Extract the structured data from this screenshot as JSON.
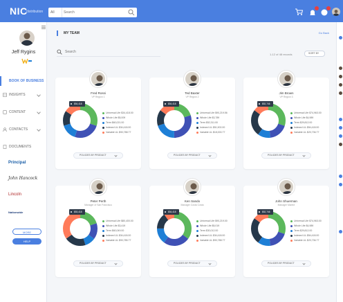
{
  "app": {
    "logo": "NIC",
    "logo_sub": "distribution"
  },
  "topbar": {
    "search_filter": "All",
    "search_placeholder": "Search"
  },
  "sidebar": {
    "profile_name": "Jeff Rygins",
    "nav": [
      {
        "label": "BOOK OF BUSINESS",
        "active": true
      },
      {
        "label": "INSIGHTS",
        "chevron": true
      },
      {
        "label": "CONTENT",
        "chevron": true
      },
      {
        "label": "CONTACTS",
        "chevron": true
      },
      {
        "label": "DOCUMENTS"
      }
    ],
    "carriers": [
      "Principal",
      "John Hancock",
      "Lincoln",
      "Nationwide"
    ],
    "more_label": "MORE",
    "help_label": "HELP"
  },
  "main": {
    "title": "MY TEAM",
    "go_back": "Go Back",
    "search_placeholder": "Search",
    "count_label": "1-12 of 48 records",
    "sort_label": "SORT BY",
    "policy_button": "POLICIES BY PRODUCT"
  },
  "colors": {
    "accent": "#4a7fe0",
    "universal_life": "#5cb85c",
    "whole_life": "#3f51b5",
    "term": "#1e7fd6",
    "indexed_ul": "#26384a",
    "variable_ul": "#ff7b5a"
  },
  "team": [
    {
      "name": "Fred Rossi",
      "role": "VP Region 1",
      "total": "$54,418",
      "chart_data": {
        "type": "pie",
        "categories": [
          "Universal Life",
          "Whole Life",
          "Term",
          "Indexed UL",
          "Variable UL"
        ],
        "values": [
          30,
          25,
          15,
          14,
          16
        ],
        "legend_text": [
          "Universal Life $34,418.00",
          "Whole Life $5,009",
          "Term $60,021.00",
          "Indexed UL $34,418.00",
          "Variable UL $90,788.77"
        ]
      }
    },
    {
      "name": "Ted Baxter",
      "role": "VP Region 2",
      "total": "$54,418",
      "chart_data": {
        "type": "pie",
        "categories": [
          "Universal Life",
          "Whole Life",
          "Term",
          "Indexed UL",
          "Variable UL"
        ],
        "values": [
          20,
          30,
          20,
          15,
          15
        ],
        "legend_text": [
          "Universal Life $90,219.56",
          "Whole Life $3,789",
          "Term $52,311.00",
          "Indexed UL $51,902.00",
          "Variable UL $18,000.77"
        ]
      }
    },
    {
      "name": "Jim Brown",
      "role": "VP Region 3",
      "total": "$52,746",
      "chart_data": {
        "type": "pie",
        "categories": [
          "Universal Life",
          "Whole Life",
          "Term",
          "Indexed UL",
          "Variable UL"
        ],
        "values": [
          30,
          18,
          12,
          25,
          15
        ],
        "legend_text": [
          "Universal Life $74,963.00",
          "Whole Life $4,989",
          "Term $29,812.00",
          "Indexed UL $54,418.00",
          "Variable UL $20,736.77"
        ]
      }
    },
    {
      "name": "Peter Perth",
      "role": "Manager of San Francisco",
      "total": "$53,418",
      "chart_data": {
        "type": "pie",
        "categories": [
          "Universal Life",
          "Whole Life",
          "Term",
          "Indexed UL",
          "Variable UL"
        ],
        "values": [
          20,
          15,
          10,
          20,
          35
        ],
        "legend_text": [
          "Universal Life $80,400.00",
          "Whole Life $3,419",
          "Term $60,049.00",
          "Indexed UL $34,418.00",
          "Variable UL $90,785.77"
        ]
      }
    },
    {
      "name": "Ken Sando",
      "role": "Manager Costa Costa",
      "total": "$54,418",
      "chart_data": {
        "type": "pie",
        "categories": [
          "Universal Life",
          "Whole Life",
          "Term",
          "Indexed UL",
          "Variable UL"
        ],
        "values": [
          35,
          25,
          15,
          15,
          10
        ],
        "legend_text": [
          "Universal Life $90,219.00",
          "Whole Life $5,019",
          "Term $30,012.00",
          "Indexed UL $34,418.00",
          "Variable UL $90,788.77"
        ]
      }
    },
    {
      "name": "John Shuerman",
      "role": "Manager Marine",
      "total": "$52,746",
      "chart_data": {
        "type": "pie",
        "categories": [
          "Universal Life",
          "Whole Life",
          "Term",
          "Indexed UL",
          "Variable UL"
        ],
        "values": [
          30,
          18,
          12,
          25,
          15
        ],
        "legend_text": [
          "Universal Life $74,963.00",
          "Whole Life $4,989",
          "Term $29,812.00",
          "Indexed UL $54,418.00",
          "Variable UL $20,736.77"
        ]
      }
    }
  ]
}
